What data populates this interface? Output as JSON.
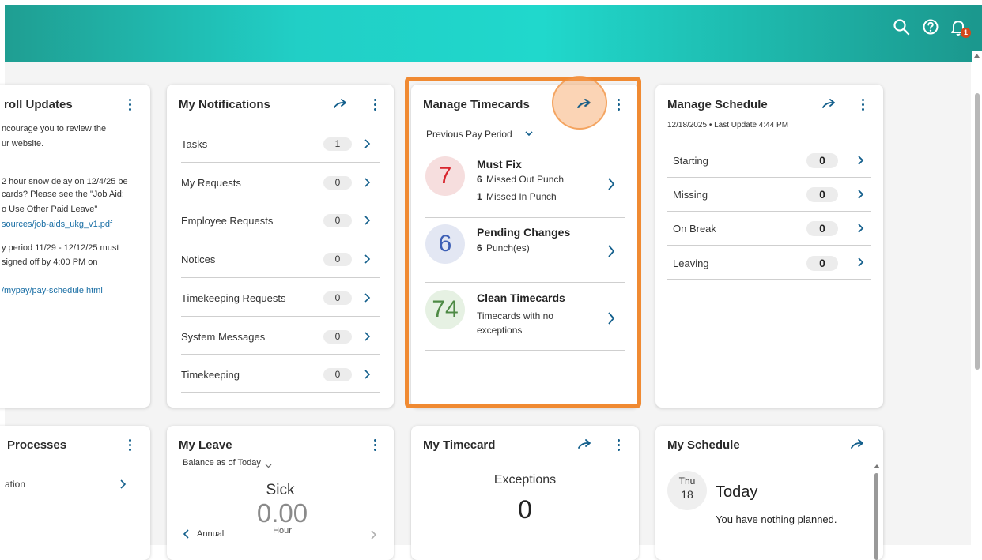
{
  "header": {
    "search_icon": "search-icon",
    "help_icon": "help-icon",
    "bell_icon": "bell-icon",
    "notification_count": "1",
    "accent": "#20d8cc"
  },
  "payroll_card": {
    "title": "roll Updates",
    "lines": [
      "ncourage you to review the",
      "ur website.",
      "2 hour snow delay on 12/4/25 be",
      "cards? Please see the \"Job Aid:",
      "o Use Other Paid Leave\"",
      "sources/job-aids_ukg_v1.pdf",
      "y period 11/29 - 12/12/25 must",
      " signed off by 4:00 PM on",
      "/mypay/pay-schedule.html"
    ]
  },
  "notifications_card": {
    "title": "My Notifications",
    "rows": [
      {
        "label": "Tasks",
        "count": "1"
      },
      {
        "label": "My Requests",
        "count": "0"
      },
      {
        "label": "Employee Requests",
        "count": "0"
      },
      {
        "label": "Notices",
        "count": "0"
      },
      {
        "label": "Timekeeping Requests",
        "count": "0"
      },
      {
        "label": "System Messages",
        "count": "0"
      },
      {
        "label": "Timekeeping",
        "count": "0"
      }
    ]
  },
  "timecards_card": {
    "title": "Manage Timecards",
    "period": "Previous Pay Period",
    "highlight_color": "#f08a32",
    "items": [
      {
        "number": "7",
        "title": "Must Fix",
        "sub1_count": "6",
        "sub1_text": "Missed Out Punch",
        "sub2_count": "1",
        "sub2_text": "Missed In Punch",
        "color": "#d8262e"
      },
      {
        "number": "6",
        "title": "Pending Changes",
        "sub1_count": "6",
        "sub1_text": "Punch(es)",
        "color": "#3d5fb5"
      },
      {
        "number": "74",
        "title": "Clean Timecards",
        "sub1_text": "Timecards with no",
        "sub2_text": "exceptions",
        "color": "#4e8a45"
      }
    ]
  },
  "schedule_card": {
    "title": "Manage Schedule",
    "date_line": "12/18/2025 • Last Update 4:44 PM",
    "rows": [
      {
        "label": "Starting",
        "count": "0"
      },
      {
        "label": "Missing",
        "count": "0"
      },
      {
        "label": "On Break",
        "count": "0"
      },
      {
        "label": "Leaving",
        "count": "0"
      }
    ]
  },
  "processes_card": {
    "title": "Processes",
    "item": "ation"
  },
  "leave_card": {
    "title": "My Leave",
    "balance_label": "Balance as of Today",
    "type": "Sick",
    "value": "0.00",
    "unit": "Hour",
    "prev_label": "Annual"
  },
  "my_timecard_card": {
    "title": "My Timecard",
    "label": "Exceptions",
    "value": "0"
  },
  "my_schedule_card": {
    "title": "My Schedule",
    "day_abbr": "Thu",
    "day_num": "18",
    "today_label": "Today",
    "message": "You have nothing planned."
  }
}
